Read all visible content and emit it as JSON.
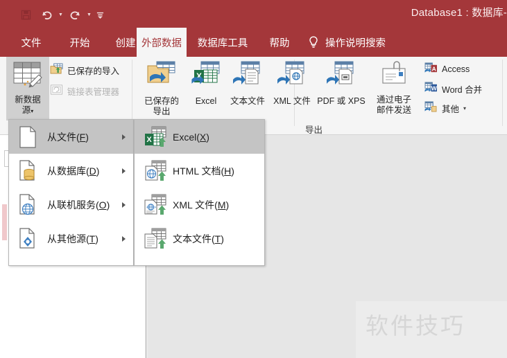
{
  "window": {
    "title": "Database1 : 数据库- ",
    "quick_access": [
      {
        "name": "save",
        "glyph": "💾",
        "label": "保存"
      },
      {
        "name": "undo",
        "glyph": "↶",
        "label": "撤消"
      },
      {
        "name": "redo",
        "glyph": "↷",
        "label": "恢复"
      },
      {
        "name": "customize",
        "glyph": "≡",
        "label": "自定义快速访问工具栏"
      }
    ]
  },
  "ribbon": {
    "tabs": [
      {
        "label": "文件",
        "active": false
      },
      {
        "label": "开始",
        "active": false
      },
      {
        "label": "创建",
        "active": false
      },
      {
        "label": "外部数据",
        "active": true
      },
      {
        "label": "数据库工具",
        "active": false
      },
      {
        "label": "帮助",
        "active": false
      }
    ],
    "tellme": "操作说明搜索",
    "groups": [
      {
        "label": "导出"
      }
    ],
    "buttons": {
      "new_data_source": {
        "line1": "新数据",
        "line2": "源",
        "caret": "▾"
      },
      "saved_imports": "已保存的导入",
      "linked_table_manager": "链接表管理器",
      "saved_exports": {
        "line1": "已保存的",
        "line2": "导出"
      },
      "excel": "Excel",
      "text_file": "文本文件",
      "xml_file": "XML 文件",
      "pdf_or_xps": "PDF 或 XPS",
      "email": {
        "line1": "通过电子",
        "line2": "邮件发送"
      },
      "access": "Access",
      "word_merge": "Word 合并",
      "more": "其他",
      "more_caret": "▾"
    }
  },
  "menus": {
    "new_data_source": {
      "items": [
        {
          "label_pre": "从文件(",
          "label_key": "F",
          "label_post": ")",
          "icon": "file-icon",
          "has_submenu": true,
          "highlighted": true
        },
        {
          "label_pre": "从数据库(",
          "label_key": "D",
          "label_post": ")",
          "icon": "database-icon",
          "has_submenu": true,
          "highlighted": false
        },
        {
          "label_pre": "从联机服务(",
          "label_key": "O",
          "label_post": ")",
          "icon": "online-service-icon",
          "has_submenu": true,
          "highlighted": false
        },
        {
          "label_pre": "从其他源(",
          "label_key": "T",
          "label_post": ")",
          "icon": "other-source-icon",
          "has_submenu": true,
          "highlighted": false
        }
      ]
    },
    "from_file": {
      "items": [
        {
          "label_pre": "Excel(",
          "label_key": "X",
          "label_post": ")",
          "icon": "excel-icon",
          "highlighted": true
        },
        {
          "label_pre": "HTML 文档(",
          "label_key": "H",
          "label_post": ")",
          "icon": "html-doc-icon",
          "highlighted": false
        },
        {
          "label_pre": "XML 文件(",
          "label_key": "M",
          "label_post": ")",
          "icon": "xml-file-icon",
          "highlighted": false
        },
        {
          "label_pre": "文本文件(",
          "label_key": "T",
          "label_post": ")",
          "icon": "text-file-icon",
          "highlighted": false
        }
      ]
    }
  },
  "workspace": {
    "watermark": "软件技巧"
  },
  "colors": {
    "accent": "#a4373a",
    "ribbon_bg": "#f5f5f5",
    "work_bg": "#e6e6e6",
    "menu_highlight": "#c4c4c4",
    "excel_green": "#217346",
    "access_red": "#a4373a",
    "word_blue": "#2b579a"
  }
}
